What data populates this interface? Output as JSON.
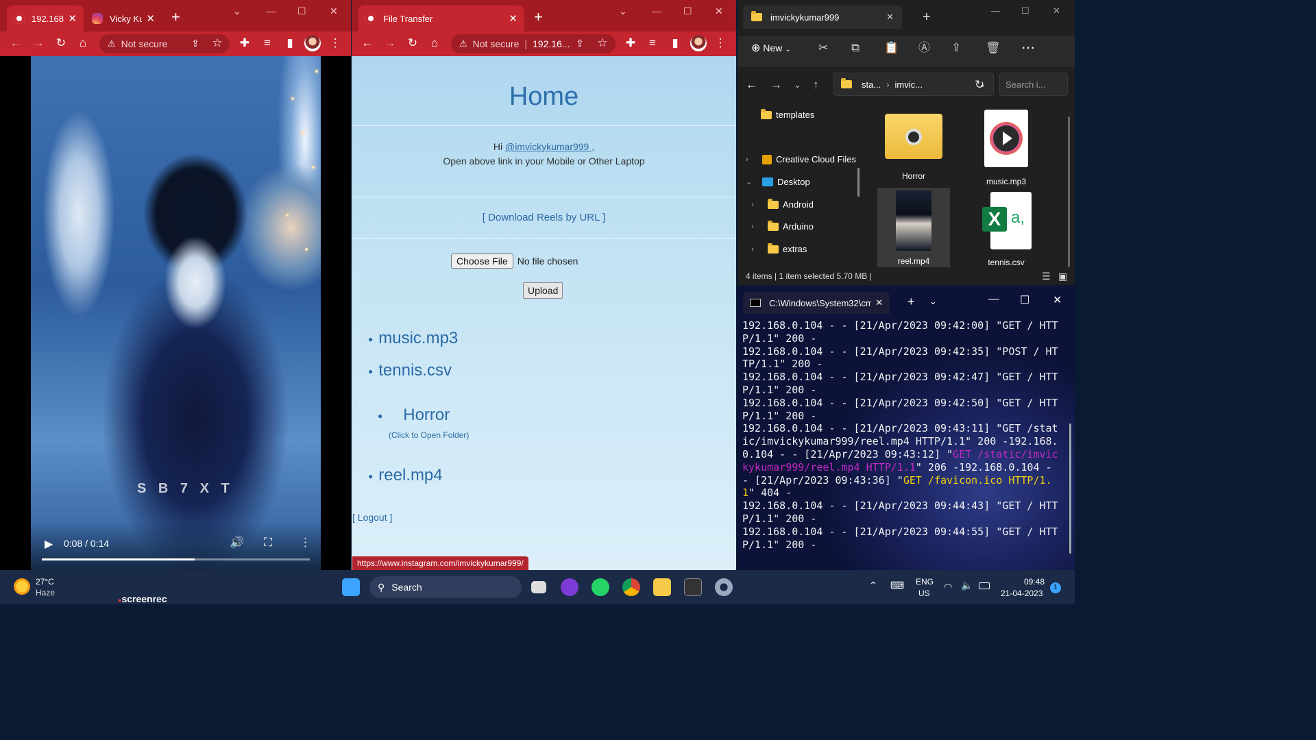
{
  "browser1": {
    "tab1_title": "192.168.(",
    "tab2_title": "Vicky Ku",
    "new_tab": "+",
    "address_text": "Not secure",
    "video": {
      "time": "0:08 / 0:14",
      "progress": 0.57,
      "watermark": "S B 7 X T"
    }
  },
  "browser2": {
    "tab_title": "File Transfer",
    "new_tab": "+",
    "address_warning": "Not secure",
    "address_url": "192.16...",
    "page": {
      "heading": "Home",
      "greet_prefix": "Hi ",
      "user_link": "@imvickykumar999 ,",
      "greet_line2": "Open above link in your Mobile or Other Laptop",
      "download_link": "[ Download Reels by URL ]",
      "choose_file": "Choose File",
      "no_file": "No file chosen",
      "upload": "Upload",
      "files": [
        "music.mp3",
        "tennis.csv"
      ],
      "folder": "Horror",
      "folder_hint": "(Click to Open Folder)",
      "file_reel": "reel.mp4",
      "logout": "[ Logout ]",
      "status_url": "https://www.instagram.com/imvickykumar999/"
    }
  },
  "explorer": {
    "tab_title": "imvickykumar999",
    "new_label": "New",
    "breadcrumb": [
      "sta...",
      "imvic..."
    ],
    "search_placeholder": "Search i...",
    "tree": {
      "templates": "templates",
      "creative": "Creative Cloud Files",
      "desktop": "Desktop",
      "android": "Android",
      "arduino": "Arduino",
      "extras": "extras"
    },
    "items": [
      "Horror",
      "music.mp3",
      "reel.mp4",
      "tennis.csv"
    ],
    "status": "4 items  |  1 item selected  5.70 MB  |"
  },
  "terminal": {
    "tab_title": "C:\\Windows\\System32\\cm",
    "lines": [
      {
        "t": "192.168.0.104 - - [21/Apr/2023 09:42:00] \"GET / HTTP/1.1\" 200 -"
      },
      {
        "t": "192.168.0.104 - - [21/Apr/2023 09:42:35] \"POST / HTTP/1.1\" 200 -"
      },
      {
        "t": "192.168.0.104 - - [21/Apr/2023 09:42:47] \"GET / HTTP/1.1\" 200 -"
      },
      {
        "t": "192.168.0.104 - - [21/Apr/2023 09:42:50] \"GET / HTTP/1.1\" 200 -"
      }
    ],
    "line5a": "192.168.0.104 - - [21/Apr/2023 09:43:11] \"GET /static/imvickykumar999/reel.mp4 HTTP/1.1\" 200 -192.168.0.104 - - [21/Apr/2023 09:43:12] \"",
    "line5b": "GET /static/imvickykumar999/reel.mp4 HTTP/1.1",
    "line5c": "\" 206 -192.168.0.104 - - [21/Apr/2023 09:43:36] \"",
    "line5d": "GET /favicon.ico HTTP/1.1",
    "line5e": "\" 404 -",
    "line6": "192.168.0.104 - - [21/Apr/2023 09:44:43] \"GET / HTTP/1.1\" 200 -",
    "line7": "192.168.0.104 - - [21/Apr/2023 09:44:55] \"GET / HTTP/1.1\" 200 -"
  },
  "taskbar": {
    "temp": "27°C",
    "weather": "Haze",
    "screenrec": "screenrec",
    "search": "Search",
    "lang1": "ENG",
    "lang2": "US",
    "time": "09:48",
    "date": "21-04-2023",
    "notif": "1"
  },
  "colors": {
    "chrome_frame": "#a31b22",
    "chrome_toolbar": "#c4252f",
    "page_bg": "#aed7ee",
    "link": "#2c6aa6"
  }
}
